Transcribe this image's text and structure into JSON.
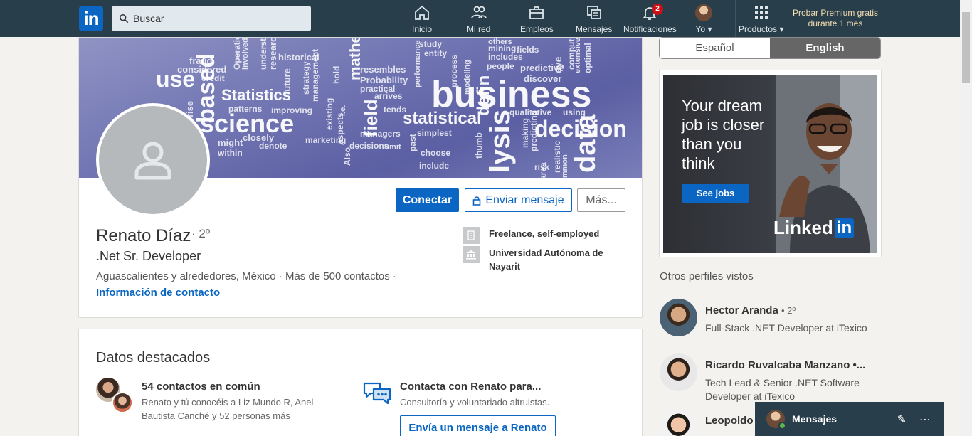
{
  "nav": {
    "search_placeholder": "Buscar",
    "items": [
      {
        "label": "Inicio"
      },
      {
        "label": "Mi red"
      },
      {
        "label": "Empleos"
      },
      {
        "label": "Mensajes"
      },
      {
        "label": "Notificaciones",
        "badge": "2"
      },
      {
        "label": "Yo"
      },
      {
        "label": "Productos"
      }
    ],
    "premium": "Probar Premium gratis durante 1 mes"
  },
  "banner_words": [
    "fraud",
    "considered",
    "use",
    "credit",
    "prise",
    "based",
    "Operations",
    "involved",
    "understand",
    "research",
    "future",
    "historical",
    "strategy",
    "management",
    "hold",
    "i.e.",
    "Statistics",
    "patterns",
    "improving",
    "science",
    "mathematics",
    "make",
    "existing",
    "aspects",
    "Also",
    "resembles",
    "Probability",
    "practical",
    "arrives",
    "tends",
    "field",
    "managers",
    "study",
    "entity",
    "performance",
    "past",
    "process",
    "simplest",
    "choose",
    "include",
    "mining",
    "includes",
    "people",
    "others",
    "defin",
    "modeling",
    "thumb",
    "lysis",
    "fields",
    "predictive",
    "discover",
    "qualitative",
    "using",
    "business",
    "statistical",
    "decision",
    "making",
    "predicting",
    "area",
    "risk",
    "realistic",
    "eye",
    "computer",
    "extensive",
    "optimal",
    "data",
    "common",
    "might",
    "within",
    "closely",
    "denote",
    "marketing",
    "decisions",
    "limit"
  ],
  "profile": {
    "name": "Renato Díaz",
    "degree": "· 2º",
    "headline": ".Net Sr. Developer",
    "location": "Aguascalientes y alrededores, México  ·  Más de 500 contactos  ·",
    "contact_info": "Información de contacto",
    "connect_label": "Conectar",
    "message_label": "Enviar mensaje",
    "more_label": "Más...",
    "experience": "Freelance, self-employed",
    "education": "Universidad Autónoma de Nayarit"
  },
  "highlights": {
    "title": "Datos destacados",
    "mutual_title": "54 contactos en común",
    "mutual_sub": "Renato y tú conocéis a Liz Mundo R, Anel Bautista Canché y 52 personas más",
    "contact_title": "Contacta con Renato para...",
    "contact_sub": "Consultoría y voluntariado altruistas.",
    "contact_button": "Envía un mensaje a Renato"
  },
  "language": {
    "spanish": "Español",
    "english": "English",
    "active": "English"
  },
  "ad": {
    "headline": "Your dream job is closer than you think",
    "button": "See jobs",
    "brand_text": "Linked",
    "brand_in": "in"
  },
  "rail": {
    "title": "Otros perfiles vistos",
    "profiles": [
      {
        "name": "Hector Aranda",
        "degree": "• 2º",
        "title": "Full-Stack .NET Developer at iTexico"
      },
      {
        "name": "Ricardo Ruvalcaba Manzano •...",
        "degree": "",
        "title": "Tech Lead & Senior .NET Software Developer at iTexico"
      },
      {
        "name": "Leopoldo",
        "degree": "",
        "title": ""
      }
    ]
  },
  "messaging": {
    "label": "Mensajes"
  },
  "colors": {
    "nav_bg": "#283e4a",
    "brand_blue": "#0a66c2",
    "badge_red": "#cc1016"
  }
}
